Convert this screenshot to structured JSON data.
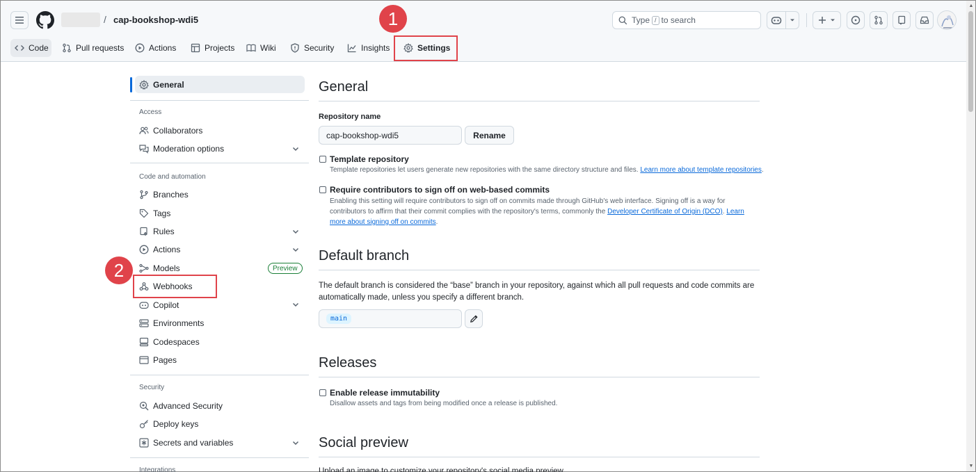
{
  "header": {
    "repo_name": "cap-bookshop-wdi5",
    "separator": "/",
    "search": {
      "prefix": "Type",
      "key": "/",
      "suffix": "to search"
    }
  },
  "tabs": [
    {
      "label": "Code"
    },
    {
      "label": "Pull requests"
    },
    {
      "label": "Actions"
    },
    {
      "label": "Projects"
    },
    {
      "label": "Wiki"
    },
    {
      "label": "Security"
    },
    {
      "label": "Insights"
    },
    {
      "label": "Settings"
    }
  ],
  "annotations": {
    "one": "1",
    "two": "2",
    "color": "#e0434a"
  },
  "sidebar": {
    "general": "General",
    "access_heading": "Access",
    "collaborators": "Collaborators",
    "moderation": "Moderation options",
    "code_heading": "Code and automation",
    "branches": "Branches",
    "tags": "Tags",
    "rules": "Rules",
    "actions": "Actions",
    "models": "Models",
    "preview": "Preview",
    "webhooks": "Webhooks",
    "copilot": "Copilot",
    "environments": "Environments",
    "codespaces": "Codespaces",
    "pages": "Pages",
    "security_heading": "Security",
    "advanced_security": "Advanced Security",
    "deploy_keys": "Deploy keys",
    "secrets": "Secrets and variables",
    "integrations_heading": "Integrations"
  },
  "main": {
    "general_title": "General",
    "repo_name_label": "Repository name",
    "repo_name_value": "cap-bookshop-wdi5",
    "rename_button": "Rename",
    "template": {
      "title": "Template repository",
      "desc": "Template repositories let users generate new repositories with the same directory structure and files.",
      "link": "Learn more about template repositories",
      "end": "."
    },
    "signoff": {
      "title": "Require contributors to sign off on web-based commits",
      "line1": "Enabling this setting will require contributors to sign off on commits made through GitHub's web interface. Signing off is a way for",
      "line2a": "contributors to affirm that their commit complies with the repository's terms, commonly the",
      "link1": "Developer Certificate of Origin (DCO)",
      "mid": ".",
      "link2a": "Learn",
      "link2b": "more about signing off on commits",
      "end": "."
    },
    "default_branch_title": "Default branch",
    "default_branch_line1": "The default branch is considered the “base” branch in your repository, against which all pull requests and code commits are",
    "default_branch_line2": "automatically made, unless you specify a different branch.",
    "branch_value": "main",
    "releases_title": "Releases",
    "immutability": {
      "title": "Enable release immutability",
      "desc": "Disallow assets and tags from being modified once a release is published."
    },
    "social_title": "Social preview",
    "social_desc": "Upload an image to customize your repository's social media preview."
  }
}
